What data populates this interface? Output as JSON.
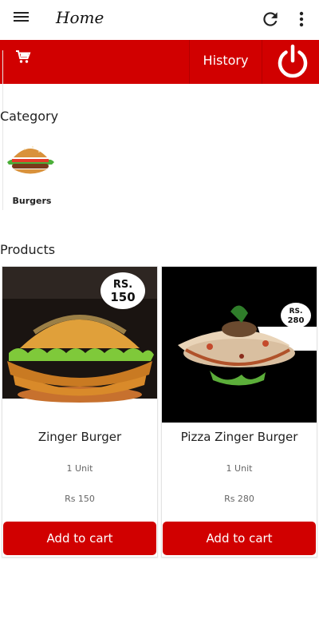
{
  "appbar": {
    "title": "Home",
    "menu_icon": "menu-icon",
    "refresh_icon": "refresh-icon",
    "more_icon": "more-vert-icon"
  },
  "topbar": {
    "cart_icon": "cart-icon",
    "history_label": "History",
    "power_icon": "power-icon",
    "background_color": "#d10000"
  },
  "sections": {
    "category_title": "Category",
    "products_title": "Products"
  },
  "categories": [
    {
      "label": "Burgers",
      "image_icon": "burger-image"
    }
  ],
  "products": [
    {
      "name": "Zinger Burger",
      "unit": "1 Unit",
      "price": "Rs 150",
      "badge": [
        "RS.",
        "150"
      ],
      "add_label": "Add to cart"
    },
    {
      "name": "Pizza Zinger Burger",
      "unit": "1 Unit",
      "price": "Rs 280",
      "badge": [
        "RS.",
        "280"
      ],
      "add_label": "Add to cart"
    }
  ],
  "colors": {
    "accent": "#d10000",
    "card_border": "#e3e3e3"
  }
}
